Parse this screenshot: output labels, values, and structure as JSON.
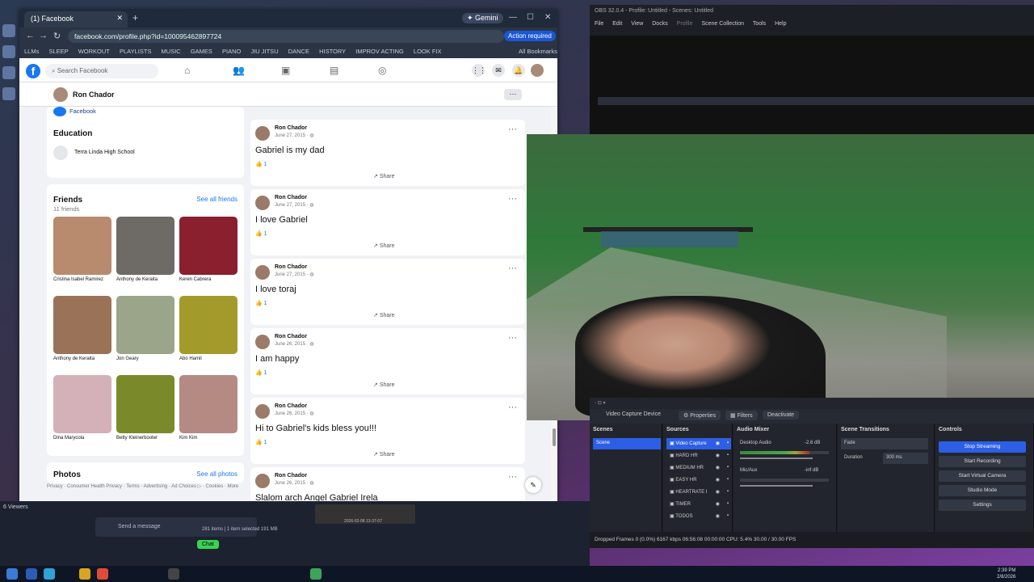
{
  "browser": {
    "tab_title": "(1) Facebook",
    "gemini_label": "Gemini",
    "url": "facebook.com/profile.php?id=100095462897724",
    "action_required": "Action required",
    "bookmarks": [
      "LLMs",
      "SLEEP",
      "WORKOUT",
      "PLAYLISTS",
      "MUSIC",
      "GAMES",
      "PIANO",
      "JIU JITSU",
      "DANCE",
      "HISTORY",
      "IMPROV ACTING",
      "LOOK FIX",
      "All Bookmarks"
    ]
  },
  "facebook": {
    "search_placeholder": "Search Facebook",
    "profile_name": "Ron Chador",
    "intro_link": "Facebook",
    "education_heading": "Education",
    "school": "Terra Linda High School",
    "friends_heading": "Friends",
    "friends_count": "11 friends",
    "see_all_friends": "See all friends",
    "friends": [
      {
        "name": "Cristina Isabel Ramirez",
        "color": "#b88a6e"
      },
      {
        "name": "Anthony de Keraita",
        "color": "#6e6a66"
      },
      {
        "name": "Keren Cabrera",
        "color": "#8a1f2e"
      },
      {
        "name": "Anthony de Keraita",
        "color": "#9a7258"
      },
      {
        "name": "Jon Geary",
        "color": "#9aa58a"
      },
      {
        "name": "Abo Hamil",
        "color": "#a39a2c"
      },
      {
        "name": "Dina Marycola",
        "color": "#d4b0b8"
      },
      {
        "name": "Betty Kleinerbooter",
        "color": "#7a8a2a"
      },
      {
        "name": "Kim Kim",
        "color": "#b48a82"
      }
    ],
    "photos_heading": "Photos",
    "see_all_photos": "See all photos",
    "footer": "Privacy · Consumer Health Privacy · Terms · Advertising · Ad Choices ▷ · Cookies · More",
    "share_label": "Share",
    "posts": [
      {
        "author": "Ron Chador",
        "date": "June 27, 2015 · ",
        "text": "Gabriel is my dad",
        "likes": "1"
      },
      {
        "author": "Ron Chador",
        "date": "June 27, 2015 · ",
        "text": "I love Gabriel",
        "likes": "1"
      },
      {
        "author": "Ron Chador",
        "date": "June 27, 2015 · ",
        "text": "I love toraj",
        "likes": "1"
      },
      {
        "author": "Ron Chador",
        "date": "June 26, 2015 · ",
        "text": "I am happy",
        "likes": "1"
      },
      {
        "author": "Ron Chador",
        "date": "June 26, 2015 · ",
        "text": "Hi to Gabriel's kids bless you!!!",
        "likes": "1"
      },
      {
        "author": "Ron Chador",
        "date": "June 26, 2015 · ",
        "text": "Slalom arch Angel Gabriel Irela",
        "likes": ""
      }
    ]
  },
  "obs": {
    "title": "OBS 32.0.4 - Profile: Untitled - Scenes: Untitled",
    "menu": [
      "File",
      "Edit",
      "View",
      "Docks",
      "Profile",
      "Scene Collection",
      "Tools",
      "Help"
    ],
    "source_label": "Video Capture Device",
    "properties": "Properties",
    "filters": "Filters",
    "deactivate": "Deactivate",
    "scenes_title": "Scenes",
    "scenes": [
      "Scene"
    ],
    "sources_title": "Sources",
    "sources": [
      "Video Capture",
      "HARD HR",
      "MEDIUM HR",
      "EASY HR",
      "HEARTRATE I",
      "TIMER",
      "TODOS"
    ],
    "mixer_title": "Audio Mixer",
    "mixer": [
      {
        "name": "Desktop Audio",
        "db": "-2.6 dB",
        "level": 0.78
      },
      {
        "name": "Mic/Aux",
        "db": "-inf dB",
        "level": 0.0
      }
    ],
    "transitions_title": "Scene Transitions",
    "transition": "Fade",
    "duration_label": "Duration",
    "duration": "300 ms",
    "controls_title": "Controls",
    "controls": [
      "Stop Streaming",
      "Start Recording",
      "Start Virtual Camera",
      "Studio Mode",
      "Settings"
    ],
    "status": "Dropped Frames 0 (0.0%)     6167 kbps     06:56:08     00:00:00     CPU: 5.4%     30.00 / 30.00 FPS"
  },
  "desktop": {
    "viewers": "6 Viewers",
    "send_message": "Send a message",
    "chat_button": "Chat",
    "files_status": "281 items  |  1 item selected  191 MB",
    "clip_name": "2026-02-08 13-37-07",
    "clock_time": "2:39 PM",
    "clock_date": "2/8/2026"
  }
}
